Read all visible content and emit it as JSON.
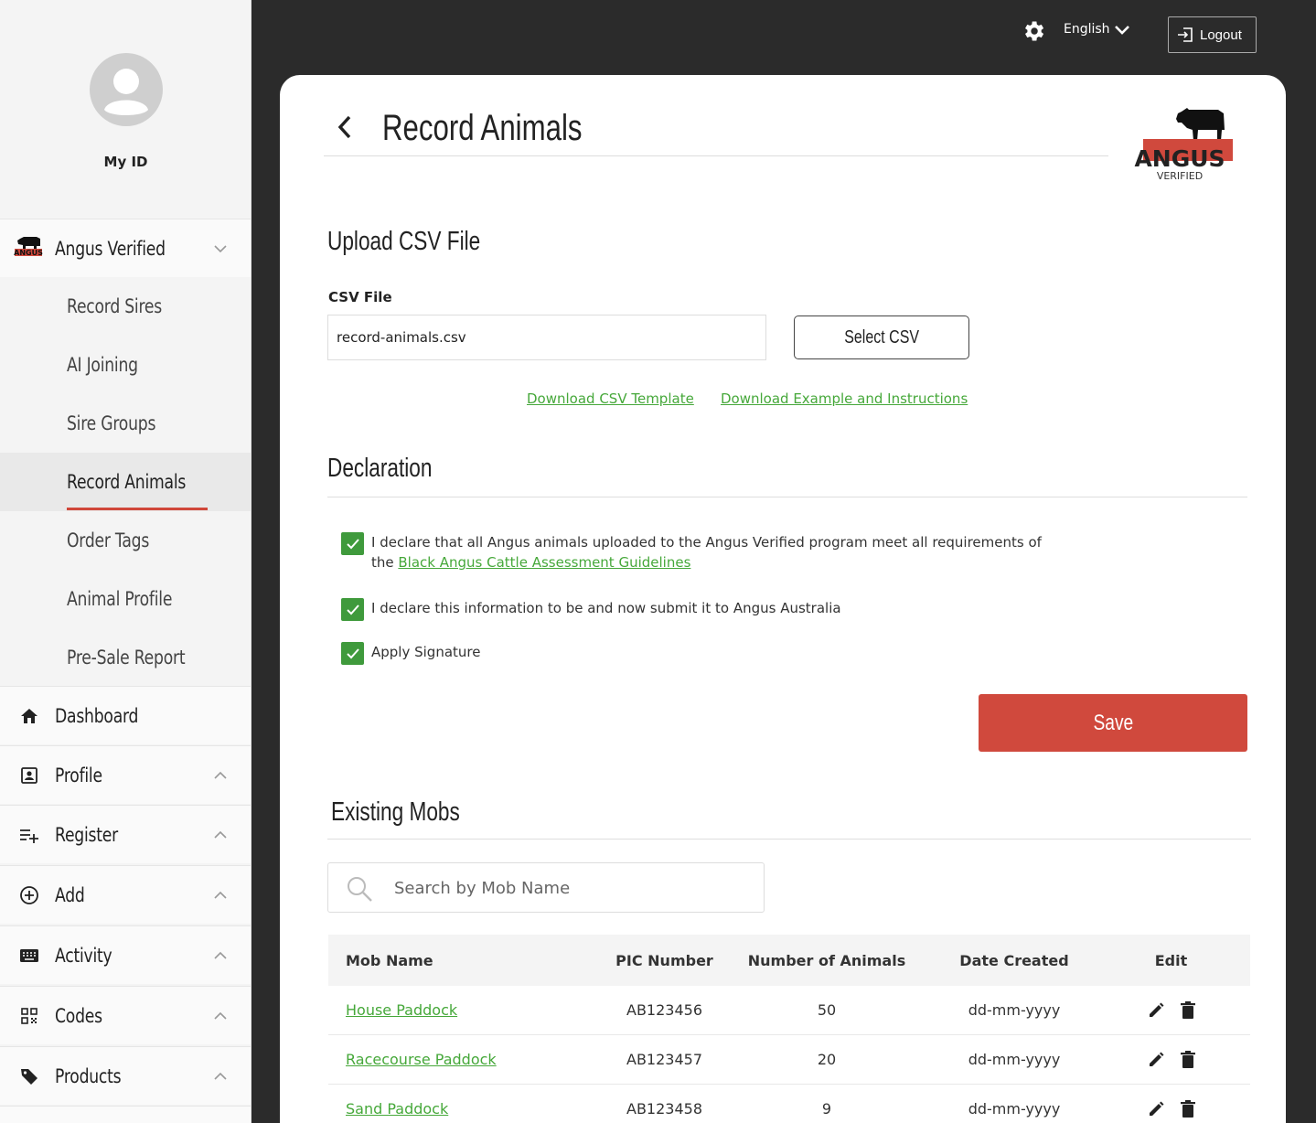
{
  "sidebar": {
    "my_id": "My ID",
    "program": {
      "label": "Angus Verified"
    },
    "sub_items": [
      {
        "label": "Record Sires"
      },
      {
        "label": "AI Joining"
      },
      {
        "label": "Sire Groups"
      },
      {
        "label": "Record Animals"
      },
      {
        "label": "Order Tags"
      },
      {
        "label": "Animal Profile"
      },
      {
        "label": "Pre-Sale Report"
      }
    ],
    "active_item": "Record Animals",
    "dashboard": {
      "label": "Dashboard"
    },
    "groups": [
      {
        "label": "Profile",
        "icon": "profile-card-icon"
      },
      {
        "label": "Register",
        "icon": "playlist-add-icon"
      },
      {
        "label": "Add",
        "icon": "plus-circle-icon"
      },
      {
        "label": "Activity",
        "icon": "keyboard-icon"
      },
      {
        "label": "Codes",
        "icon": "qr-code-icon"
      },
      {
        "label": "Products",
        "icon": "tag-icon"
      }
    ]
  },
  "topbar": {
    "language": "English",
    "logout_label": "Logout"
  },
  "page": {
    "title": "Record Animals",
    "logo_text": "ANGUS",
    "logo_subtext": "VERIFIED"
  },
  "upload": {
    "heading": "Upload CSV File",
    "field_label": "CSV File",
    "field_value": "record-animals.csv",
    "select_button": "Select CSV",
    "link_template": "Download CSV Template",
    "link_example": "Download Example and Instructions"
  },
  "declaration": {
    "heading": "Declaration",
    "items": [
      {
        "text": "I declare that all Angus animals uploaded to the Angus Verified program meet all requirements of",
        "text2": "the ",
        "link": "Black Angus Cattle Assessment Guidelines",
        "checked": true
      },
      {
        "text": "I declare this information to be and now submit it to Angus Australia",
        "checked": true
      },
      {
        "text": "Apply Signature",
        "checked": true
      }
    ],
    "save_label": "Save"
  },
  "mobs": {
    "heading": "Existing Mobs",
    "search_placeholder": "Search by Mob Name",
    "columns": [
      "Mob Name",
      "PIC Number",
      "Number of Animals",
      "Date Created",
      "Edit"
    ],
    "rows": [
      {
        "name": "House Paddock",
        "pic": "AB123456",
        "count": "50",
        "date": "dd-mm-yyyy"
      },
      {
        "name": "Racecourse Paddock",
        "pic": "AB123457",
        "count": "20",
        "date": "dd-mm-yyyy"
      },
      {
        "name": "Sand Paddock",
        "pic": "AB123458",
        "count": "9",
        "date": "dd-mm-yyyy"
      }
    ]
  },
  "colors": {
    "accent_red": "#d0493d",
    "link_green": "#46a83a",
    "check_green": "#3f9a3c",
    "frame_dark": "#2b2b2b"
  }
}
